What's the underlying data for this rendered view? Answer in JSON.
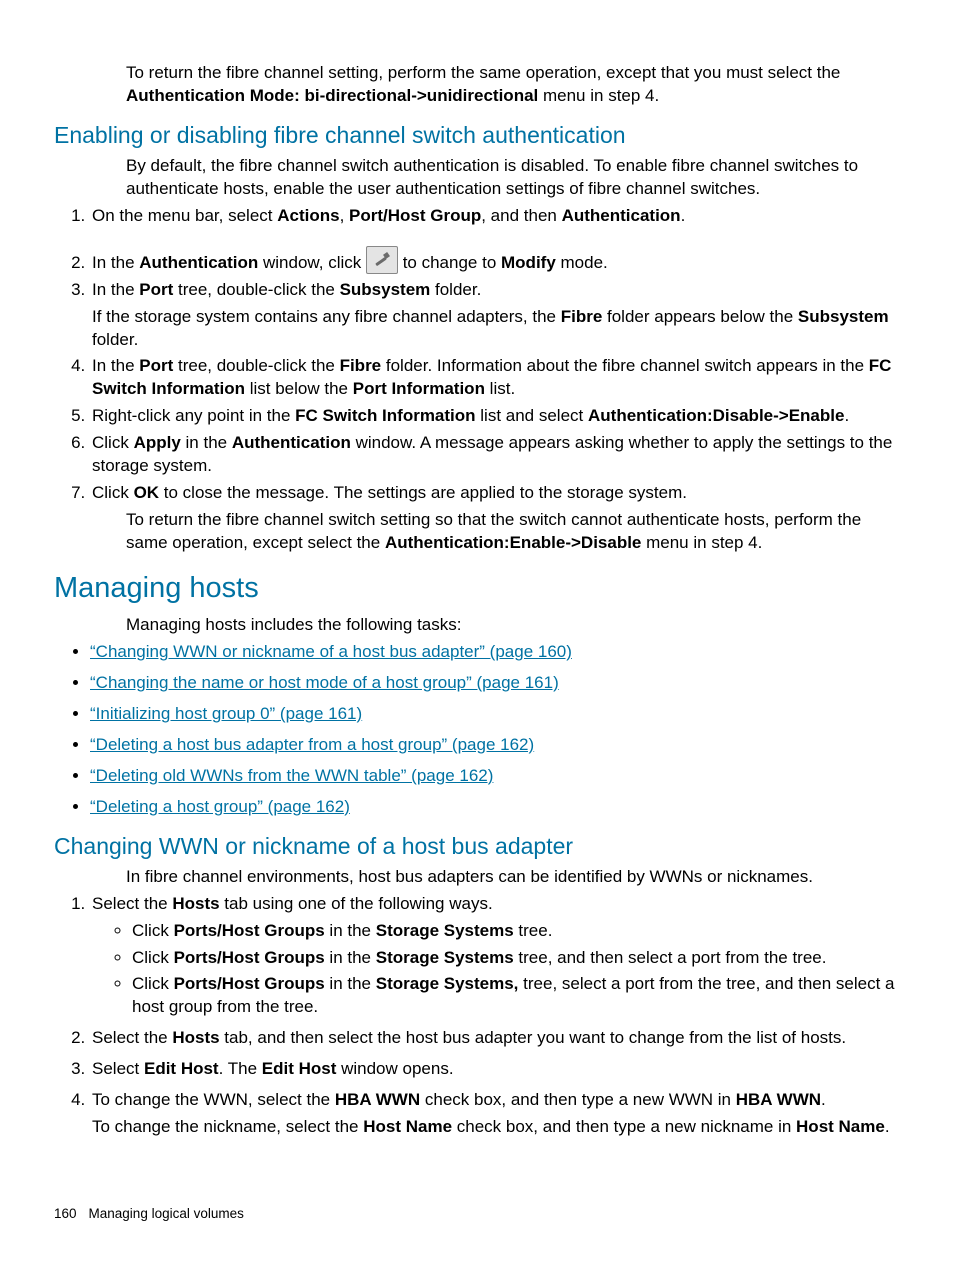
{
  "intro_p": {
    "a": "To return the fibre channel setting, perform the same operation, except that you must select the ",
    "b": "Authentication Mode: bi-directional->unidirectional",
    "c": " menu in step 4."
  },
  "h2_enable": "Enabling or disabling fibre channel switch authentication",
  "enable_intro": "By default, the fibre channel switch authentication is disabled. To enable fibre channel switches to authenticate hosts, enable the user authentication settings of fibre channel switches.",
  "enable_steps": {
    "s1": {
      "a": "On the menu bar, select ",
      "b": "Actions",
      "c": ", ",
      "d": "Port/Host Group",
      "e": ", and then ",
      "f": "Authentication",
      "g": "."
    },
    "s2": {
      "a": "In the ",
      "b": "Authentication",
      "c": " window, click ",
      "d": " to change to ",
      "e": "Modify",
      "f": " mode."
    },
    "s3": {
      "a": "In the ",
      "b": "Port",
      "c": " tree, double-click the ",
      "d": "Subsystem",
      "e": " folder."
    },
    "s3p": {
      "a": "If the storage system contains any fibre channel adapters, the ",
      "b": "Fibre",
      "c": " folder appears below the ",
      "d": "Subsystem",
      "e": " folder."
    },
    "s4": {
      "a": "In the ",
      "b": "Port",
      "c": " tree, double-click the ",
      "d": "Fibre",
      "e": " folder. Information about the fibre channel switch appears in the ",
      "f": "FC Switch Information",
      "g": " list below the ",
      "h": "Port Information",
      "i": " list."
    },
    "s5": {
      "a": "Right-click any point in the ",
      "b": "FC Switch Information",
      "c": " list and select ",
      "d": "Authentication:Disable->Enable",
      "e": "."
    },
    "s6": {
      "a": "Click ",
      "b": "Apply",
      "c": " in the ",
      "d": "Authentication",
      "e": " window. A message appears asking whether to apply the settings to the storage system."
    },
    "s7": {
      "a": "Click ",
      "b": "OK",
      "c": " to close the message. The settings are applied to the storage system."
    }
  },
  "enable_return": {
    "a": "To return the fibre channel switch setting so that the switch cannot authenticate hosts, perform the same operation, except select the ",
    "b": "Authentication:Enable->Disable",
    "c": " menu in step 4."
  },
  "h1_managing": "Managing hosts",
  "managing_intro": "Managing hosts includes the following tasks:",
  "managing_links": [
    "“Changing WWN or nickname of a host bus adapter” (page 160)",
    "“Changing the name or host mode of a host group” (page 161)",
    "“Initializing host group 0” (page 161)",
    "“Deleting a host bus adapter from a host group” (page 162)",
    "“Deleting old WWNs from the WWN table” (page 162)",
    "“Deleting a host group” (page 162)"
  ],
  "h2_change": "Changing WWN or nickname of a host bus adapter",
  "change_intro": "In fibre channel environments, host bus adapters can be identified by WWNs or nicknames.",
  "change_steps": {
    "s1": {
      "a": "Select the ",
      "b": "Hosts",
      "c": " tab using one of the following ways."
    },
    "s1b1": {
      "a": "Click ",
      "b": "Ports/Host Groups",
      "c": " in the ",
      "d": "Storage Systems",
      "e": " tree."
    },
    "s1b2": {
      "a": "Click ",
      "b": "Ports/Host Groups",
      "c": " in the ",
      "d": "Storage Systems",
      "e": " tree, and then select a port from the tree."
    },
    "s1b3": {
      "a": "Click ",
      "b": "Ports/Host Groups",
      "c": " in the ",
      "d": "Storage Systems,",
      "e": " tree, select a port from the tree, and then select a host group from the tree."
    },
    "s2": {
      "a": "Select the ",
      "b": "Hosts",
      "c": " tab, and then select the host bus adapter you want to change from the list of hosts."
    },
    "s3": {
      "a": "Select ",
      "b": "Edit Host",
      "c": ". The ",
      "d": "Edit Host",
      "e": " window opens."
    },
    "s4": {
      "a": "To change the WWN, select the ",
      "b": "HBA WWN",
      "c": " check box, and then type a new WWN in ",
      "d": "HBA WWN",
      "e": "."
    },
    "s4p": {
      "a": "To change the nickname, select the ",
      "b": "Host Name",
      "c": " check box, and then type a new nickname in ",
      "d": "Host Name",
      "e": "."
    }
  },
  "footer": {
    "page": "160",
    "title": "Managing logical volumes"
  }
}
